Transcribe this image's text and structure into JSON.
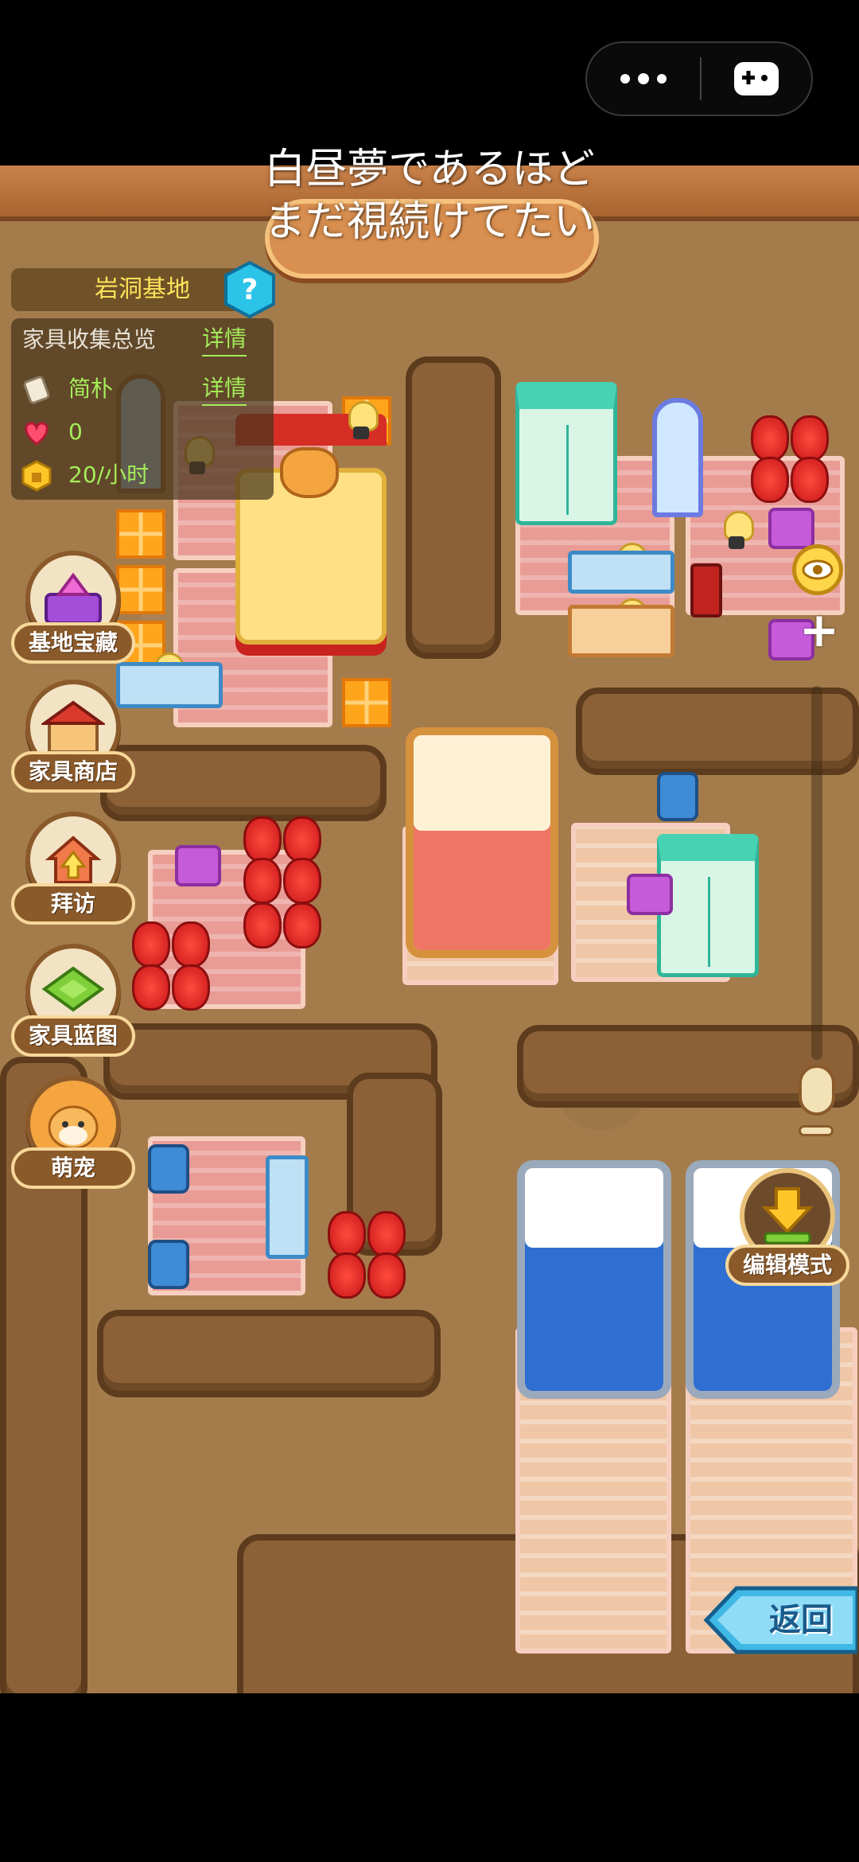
{
  "lyrics": {
    "line1": "白昼夢であるほど",
    "line2": "まだ視続けてたい"
  },
  "base": {
    "title": "岩洞基地"
  },
  "panel": {
    "header": "家具收集总览",
    "header_link": "详情",
    "style_value": "简朴",
    "style_link": "详情",
    "hearts_value": "0",
    "income_value": "20/小时"
  },
  "menu": {
    "treasure": "基地宝藏",
    "shop": "家具商店",
    "visit": "拜访",
    "blueprint": "家具蓝图",
    "pet": "萌宠"
  },
  "edit_mode_label": "编辑模式",
  "back_label": "返回",
  "colors": {
    "accent_green": "#a5ec5a",
    "title_yellow": "#ffe35a",
    "back_blue": "#3fb8e6"
  },
  "icons": [
    "more-icon",
    "gamepad-icon",
    "help-icon",
    "scroll-icon",
    "heart-icon",
    "coin-icon",
    "eye-icon",
    "plus-icon",
    "edit-arrow-icon",
    "back-arrow-icon"
  ]
}
